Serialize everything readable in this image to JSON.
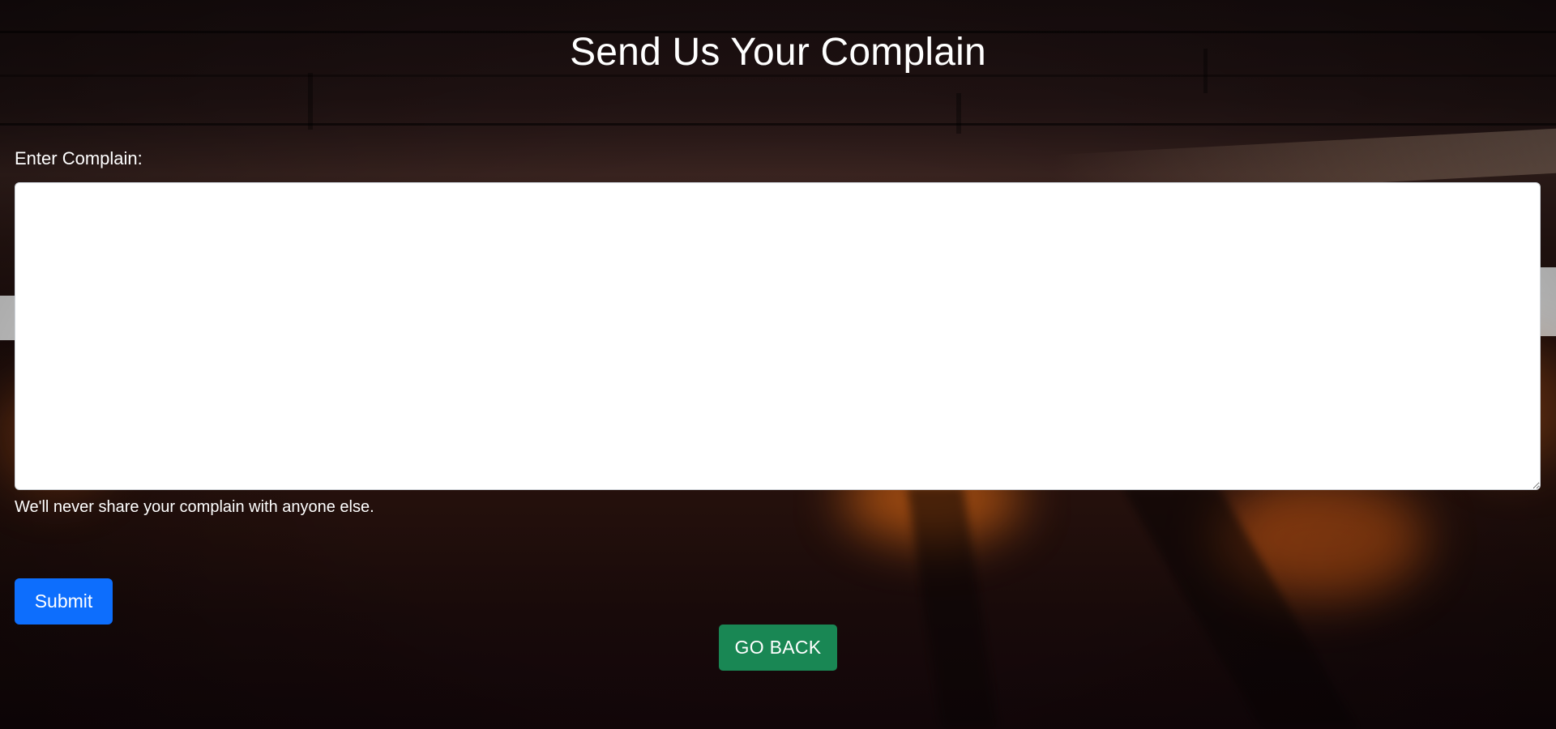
{
  "page": {
    "title": "Send Us Your Complain"
  },
  "form": {
    "complain_label": "Enter Complain:",
    "complain_value": "",
    "help_text": "We'll never share your complain with anyone else.",
    "submit_label": "Submit"
  },
  "navigation": {
    "go_back_label": "GO BACK"
  },
  "colors": {
    "submit_button": "#0d6efd",
    "go_back_button": "#198754",
    "text": "#ffffff",
    "background": "#120709"
  }
}
